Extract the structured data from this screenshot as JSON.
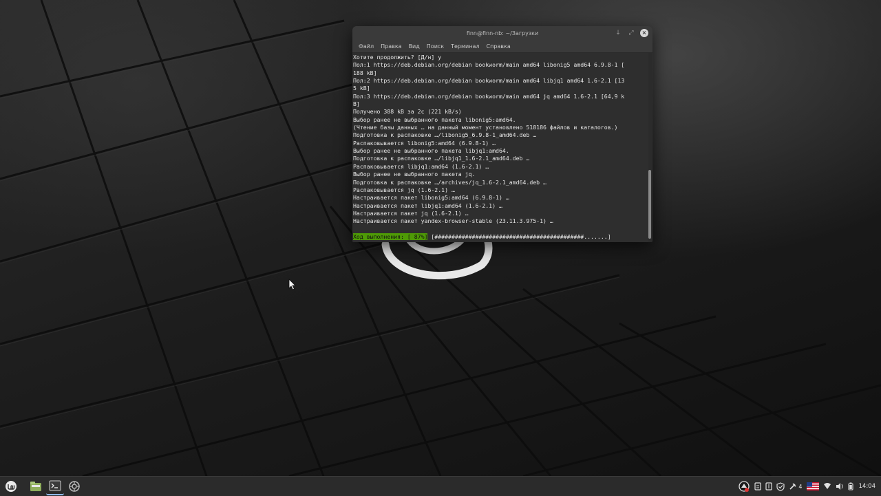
{
  "terminal": {
    "title": "finn@finn-nb: ~/Загрузки",
    "menu": [
      "Файл",
      "Правка",
      "Вид",
      "Поиск",
      "Терминал",
      "Справка"
    ],
    "lines": [
      "Хотите продолжить? [Д/н] y",
      "Пол:1 https://deb.debian.org/debian bookworm/main amd64 libonig5 amd64 6.9.8-1 [",
      "188 kB]",
      "Пол:2 https://deb.debian.org/debian bookworm/main amd64 libjq1 amd64 1.6-2.1 [13",
      "5 kB]",
      "Пол:3 https://deb.debian.org/debian bookworm/main amd64 jq amd64 1.6-2.1 [64,9 k",
      "B]",
      "Получено 388 kB за 2с (221 kB/s)",
      "Выбор ранее не выбранного пакета libonig5:amd64.",
      "(Чтение базы данных … на данный момент установлено 518186 файлов и каталогов.)",
      "Подготовка к распаковке …/libonig5_6.9.8-1_amd64.deb …",
      "Распаковывается libonig5:amd64 (6.9.8-1) …",
      "Выбор ранее не выбранного пакета libjq1:amd64.",
      "Подготовка к распаковке …/libjq1_1.6-2.1_amd64.deb …",
      "Распаковывается libjq1:amd64 (1.6-2.1) …",
      "Выбор ранее не выбранного пакета jq.",
      "Подготовка к распаковке …/archives/jq_1.6-2.1_amd64.deb …",
      "Распаковывается jq (1.6-2.1) …",
      "Настраивается пакет libonig5:amd64 (6.9.8-1) …",
      "Настраивается пакет libjq1:amd64 (1.6-2.1) …",
      "Настраивается пакет jq (1.6-2.1) …",
      "Настраивается пакет yandex-browser-stable (23.11.3.975-1) …"
    ],
    "progress_label": "Ход выполнения: [ 87%]",
    "progress_bar": " [############################################.......]",
    "progress_percent": 87
  },
  "taskbar": {
    "apps": [
      "menu-icon",
      "file-manager-icon",
      "terminal-icon",
      "settings-icon"
    ],
    "tray": {
      "notification_count": "4",
      "language_flag": "us-flag-icon",
      "clock": "14:04"
    }
  },
  "colors": {
    "progress_green": "#4e9a06",
    "terminal_bg": "#2e2e2e",
    "taskbar_bg": "#2b2b2b"
  }
}
